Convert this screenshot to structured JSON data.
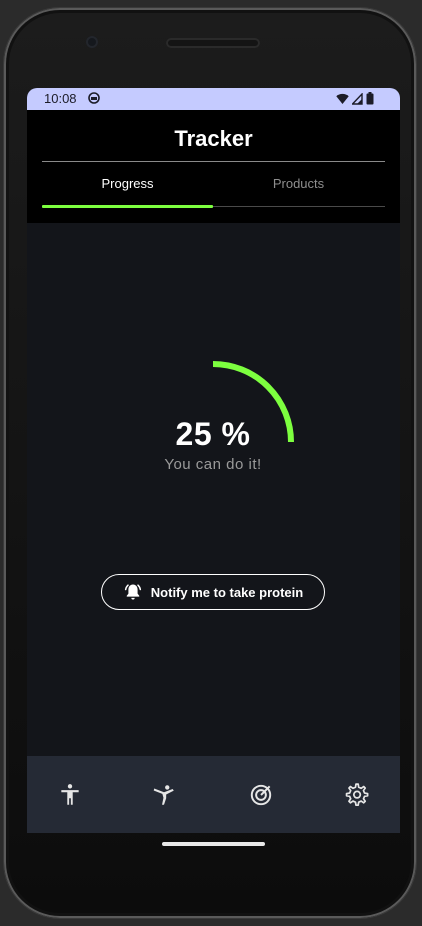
{
  "status": {
    "time": "10:08"
  },
  "app": {
    "title": "Tracker",
    "tabs": [
      {
        "label": "Progress",
        "selected": true
      },
      {
        "label": "Products",
        "selected": false
      }
    ]
  },
  "progress": {
    "percent_text": "25 %",
    "value_fraction": 0.25,
    "message": "You can do it!",
    "arc_color": "#7dff3f"
  },
  "notify_button": {
    "label": "Notify me to take protein",
    "icon": "bell-ring-icon"
  },
  "bottom_nav": [
    {
      "icon": "accessibility-icon"
    },
    {
      "icon": "karate-kick-icon"
    },
    {
      "icon": "track-changes-icon"
    },
    {
      "icon": "settings-icon"
    }
  ],
  "colors": {
    "status_bar": "#c5cbff",
    "background": "#13151a",
    "nav_background": "#252a35",
    "accent": "#7dff3f"
  }
}
